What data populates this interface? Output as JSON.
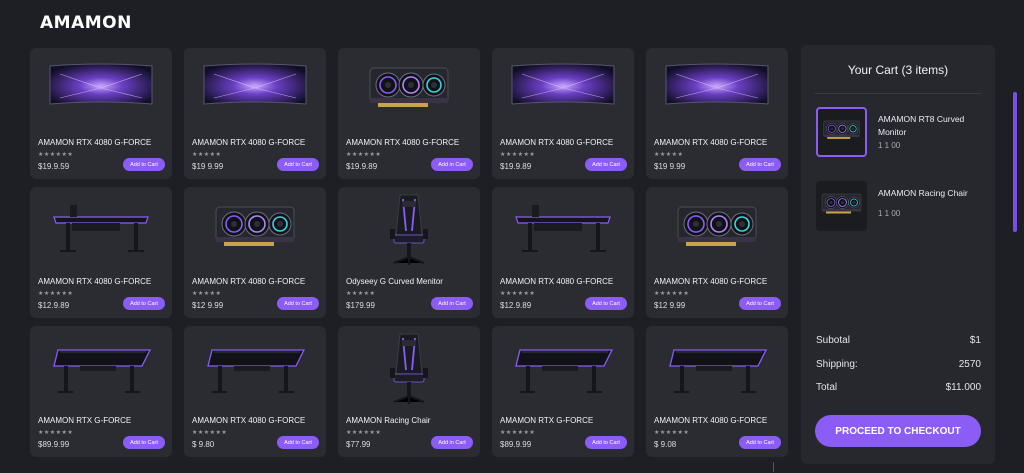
{
  "header": {
    "logo": "AMAMON"
  },
  "colors": {
    "accent": "#8b5cf6",
    "background": "#1d1f24",
    "card": "#2a2c32"
  },
  "products": [
    {
      "image": "monitor-image",
      "title": "AMAMON RTX 4080 G-FORCE",
      "rating": "★★★★★★",
      "price": "$19.9.59",
      "button": "Add to Cart"
    },
    {
      "image": "monitor-image",
      "title": "AMAMON RTX 4080 G-FORCE",
      "rating": "★★★★★",
      "price": "$19 9.99",
      "button": "Add to Cart"
    },
    {
      "image": "gpu-image",
      "title": "AMAMON RTX 4080 G-FORCE",
      "rating": "★★★★★★",
      "price": "$19.9.89",
      "button": "Add in Cart"
    },
    {
      "image": "monitor-image",
      "title": "AMAMON RTX 4080 G-FORCE",
      "rating": "★★★★★★",
      "price": "$19.9.89",
      "button": "Add to Cart"
    },
    {
      "image": "monitor-image",
      "title": "AMAMON RTX 4080 G-FORCE",
      "rating": "★★★★★",
      "price": "$19 9.99",
      "button": "Add to Cart"
    },
    {
      "image": "desk-image",
      "title": "AMAMON RTX 4080 G-FORCE",
      "rating": "★★★★★★",
      "price": "$12.9.89",
      "button": "Add to Cart"
    },
    {
      "image": "gpu-image",
      "title": "AMAMON RTX 4080 G-FORCE",
      "rating": "★★★★★",
      "price": "$12 9.99",
      "button": "Add to Cart"
    },
    {
      "image": "chair-image",
      "title": "Odyseey G Curved Menitor",
      "rating": "★★★★★",
      "price": "$179.99",
      "button": "Add in Cart"
    },
    {
      "image": "desk-image",
      "title": "AMAMON RTX 4080 G-FORCE",
      "rating": "★★★★★★",
      "price": "$12.9.89",
      "button": "Add to Cart"
    },
    {
      "image": "gpu-image",
      "title": "AMAMON RTX 4080 G-FORCE",
      "rating": "★★★★★★",
      "price": "$12 9.99",
      "button": "Add to Cart"
    },
    {
      "image": "gaming-desk-image",
      "title": "AMAMON RTX G-FORCE",
      "rating": "★★★★★★",
      "price": "$89.9.99",
      "button": "Add to Cart"
    },
    {
      "image": "gaming-desk-image",
      "title": "AMAMON RTX 4080 G-FORCE",
      "rating": "★★★★★★",
      "price": "$ 9.80",
      "button": "Add to Cart"
    },
    {
      "image": "chair-image",
      "title": "AMAMON Racing Chair",
      "rating": "★★★★★★",
      "price": "$77.99",
      "button": "Add in Cart"
    },
    {
      "image": "gaming-desk-image",
      "title": "AMAMON RTX G-FORCE",
      "rating": "★★★★★★",
      "price": "$89.9.99",
      "button": "Add to Cart"
    },
    {
      "image": "gaming-desk-image",
      "title": "AMAMON RTX 4080 G-FORCE",
      "rating": "★★★★★★",
      "price": "$ 9.08",
      "button": "Add to Cart"
    }
  ],
  "cart": {
    "title": "Your Cart (3 items)",
    "items": [
      {
        "image": "gpu-image",
        "name": "AMAMON RT8 Curved Monitor",
        "qty": "1 1   00"
      },
      {
        "image": "gpu-image",
        "name": "AMAMON Racing Chair",
        "qty": "1 1  00"
      }
    ],
    "summary": {
      "subtotal_label": "Subotal",
      "subtotal_value": "$1",
      "shipping_label": "Shipping:",
      "shipping_value": "2570",
      "total_label": "Total",
      "total_value": "$11.000"
    },
    "checkout_label": "PROCEED TO CHECKOUT"
  }
}
